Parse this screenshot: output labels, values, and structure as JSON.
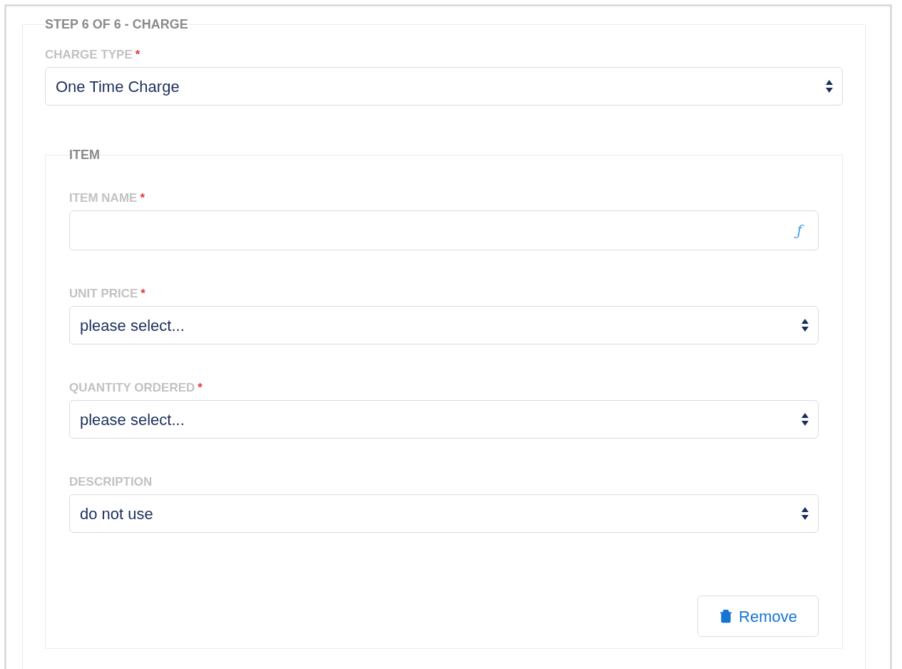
{
  "step_legend": "STEP 6 OF 6 - CHARGE",
  "charge_type": {
    "label": "CHARGE TYPE",
    "required_mark": "*",
    "kind": "select",
    "value": "One Time Charge"
  },
  "item": {
    "legend": "ITEM",
    "fields": [
      {
        "label": "ITEM NAME",
        "required_mark": "*",
        "kind": "text",
        "icon_text": "ƒ"
      },
      {
        "label": "UNIT PRICE",
        "required_mark": "*",
        "kind": "select",
        "value": "please select..."
      },
      {
        "label": "QUANTITY ORDERED",
        "required_mark": "*",
        "kind": "select",
        "value": "please select..."
      },
      {
        "label": "DESCRIPTION",
        "kind": "select",
        "value": "do not use"
      }
    ],
    "remove_button": "Remove"
  }
}
